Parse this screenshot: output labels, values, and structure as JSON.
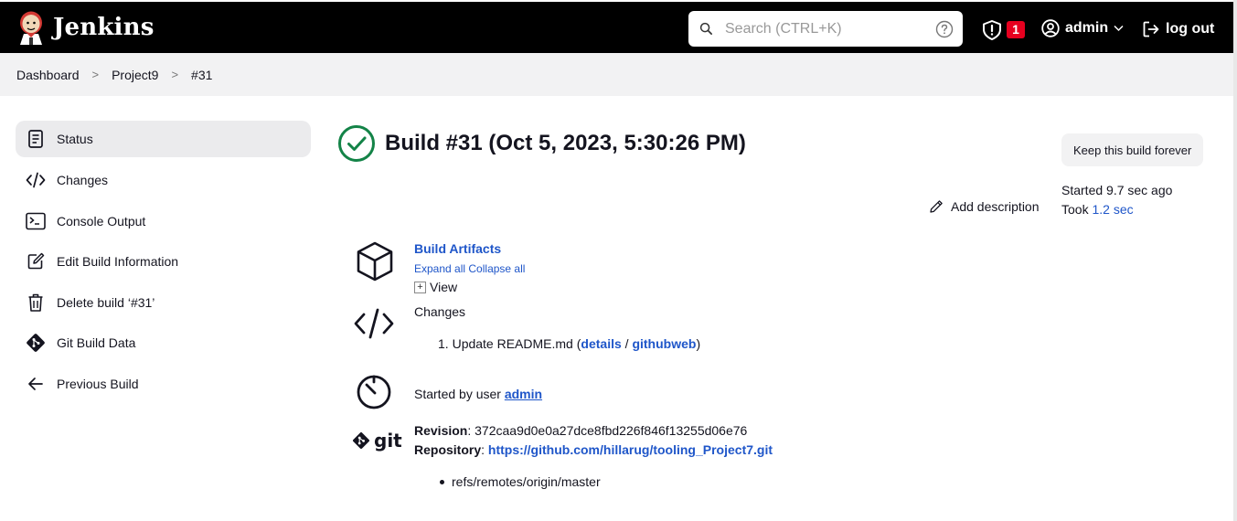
{
  "header": {
    "app_title": "Jenkins",
    "search_placeholder": "Search (CTRL+K)",
    "alert_count": "1",
    "user_name": "admin",
    "logout_label": "log out"
  },
  "breadcrumb": [
    "Dashboard",
    "Project9",
    "#31"
  ],
  "sidebar": {
    "items": [
      {
        "label": "Status",
        "icon": "document-icon"
      },
      {
        "label": "Changes",
        "icon": "code-icon"
      },
      {
        "label": "Console Output",
        "icon": "terminal-icon"
      },
      {
        "label": "Edit Build Information",
        "icon": "edit-icon"
      },
      {
        "label": "Delete build ‘#31’",
        "icon": "trash-icon"
      },
      {
        "label": "Git Build Data",
        "icon": "git-icon"
      },
      {
        "label": "Previous Build",
        "icon": "arrow-left-icon"
      }
    ]
  },
  "build": {
    "title": "Build #31 (Oct 5, 2023, 5:30:26 PM)",
    "keep_label": "Keep this build forever",
    "started_ago": "Started 9.7 sec ago",
    "took_prefix": "Took ",
    "took_value": "1.2 sec",
    "add_description": "Add description",
    "artifacts_title": "Build Artifacts",
    "expand_all": "Expand all",
    "collapse_all": "Collapse all",
    "view_label": "View",
    "changes_heading": "Changes",
    "change_number": "1.",
    "change_text": "Update README.md (",
    "change_details": "details",
    "change_sep": " / ",
    "change_githubweb": "githubweb",
    "change_close": ")",
    "started_by_prefix": "Started by user ",
    "started_by_user": "admin",
    "revision_label": "Revision",
    "revision_value": ": 372caa9d0e0a27dce8fbd226f846f13255d06e76",
    "repository_label": "Repository",
    "repository_sep": ": ",
    "repository_url": "https://github.com/hillarug/tooling_Project7.git",
    "branch": "refs/remotes/origin/master",
    "git_logo_text": "git"
  },
  "colors": {
    "success": "#138347",
    "link": "#1f56c9",
    "badge": "#e6001f"
  }
}
